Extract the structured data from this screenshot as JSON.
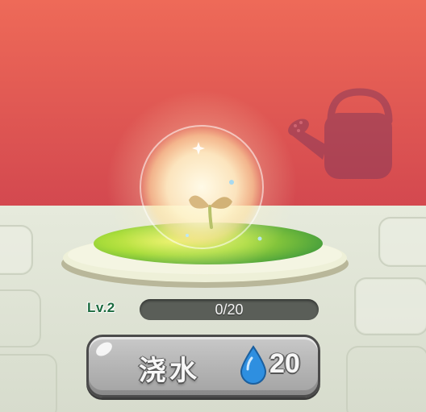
{
  "level": {
    "label": "Lv.2"
  },
  "progress": {
    "text": "0/20",
    "current": 0,
    "max": 20
  },
  "water_button": {
    "label": "浇水",
    "cost": "20",
    "cost_icon": "water-drop-icon"
  },
  "colors": {
    "wall_top": "#ee6a5a",
    "wall_bottom": "#d44e52",
    "floor": "#dfe4d6",
    "plant_bed": "#8fd43a",
    "button": "#b9b9b9",
    "progress_track": "#5a5e58",
    "level_text": "#1c6b3f",
    "drop": "#2e8fe0"
  },
  "background_icon": "watering-can-icon"
}
